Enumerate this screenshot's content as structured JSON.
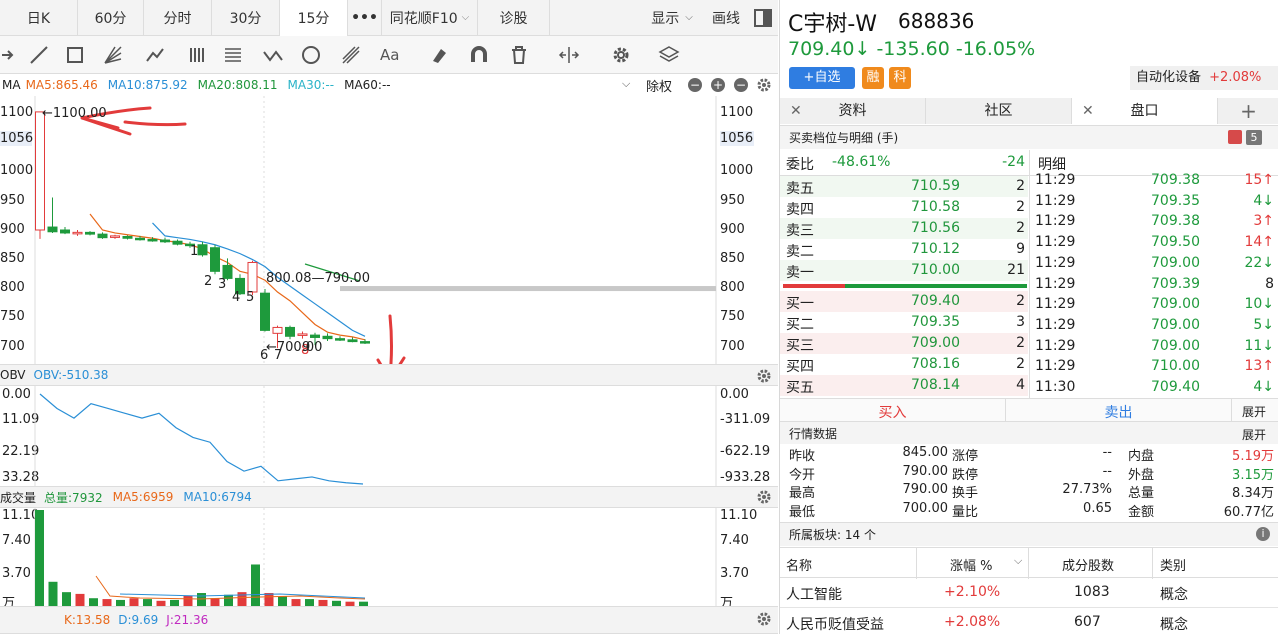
{
  "tabs": [
    "日K",
    "60分",
    "分时",
    "30分",
    "15分",
    "•••",
    "同花顺F10",
    "诊股",
    "显示",
    "画线"
  ],
  "ma_bar": {
    "ma": "MA",
    "ma5": "MA5:865.46",
    "ma10": "MA10:875.92",
    "ma20": "MA20:808.11",
    "ma30": "MA30:--",
    "ma60": "MA60:--",
    "fq": "除权"
  },
  "price_axis": {
    "left": [
      "1100",
      "1056",
      "1000",
      "950",
      "900",
      "850",
      "800",
      "750",
      "700"
    ],
    "right": [
      "1100",
      "1056",
      "1000",
      "950",
      "900",
      "850",
      "800",
      "750",
      "700"
    ]
  },
  "annotations": {
    "high": "←1100.00",
    "low": "←700.00",
    "level": "800.08—790.00",
    "digits": [
      "1",
      "2",
      "3",
      "4",
      "5",
      "6",
      "7",
      "8",
      "9"
    ]
  },
  "obv": {
    "title": "OBV",
    "value": "OBV:-510.38",
    "left": [
      "0.00",
      "11.09",
      "22.19",
      "33.28"
    ],
    "right": [
      "0.00",
      "-311.09",
      "-622.19",
      "-933.28"
    ]
  },
  "vol": {
    "title": "成交量",
    "total": "总量:7932",
    "ma5": "MA5:6959",
    "ma10": "MA10:6794",
    "left": [
      "11.10",
      "7.40",
      "3.70",
      "万"
    ],
    "right": [
      "11.10",
      "7.40",
      "3.70",
      "万"
    ]
  },
  "kdj": {
    "k": "K:13.58",
    "d": "D:9.69",
    "j": "J:21.36"
  },
  "stock": {
    "name": "C宇树-W",
    "code": "688836",
    "price": "709.40↓",
    "change": "-135.60",
    "pct": "-16.05%",
    "add": "+自选",
    "rong": "融",
    "ke": "科",
    "sector": "自动化设备",
    "sector_pct": "+2.08%"
  },
  "rtabs": [
    "资料",
    "社区",
    "盘口",
    "+"
  ],
  "orderbook": {
    "title": "买卖档位与明细 (手)",
    "badge": "5",
    "weibi_label": "委比",
    "weibi": "-48.61%",
    "weibi_diff": "-24",
    "detail_label": "明细",
    "asks": [
      {
        "l": "卖五",
        "p": "710.59",
        "v": "2"
      },
      {
        "l": "卖四",
        "p": "710.58",
        "v": "2"
      },
      {
        "l": "卖三",
        "p": "710.56",
        "v": "2"
      },
      {
        "l": "卖二",
        "p": "710.12",
        "v": "9"
      },
      {
        "l": "卖一",
        "p": "710.00",
        "v": "21"
      }
    ],
    "bids": [
      {
        "l": "买一",
        "p": "709.40",
        "v": "2"
      },
      {
        "l": "买二",
        "p": "709.35",
        "v": "3"
      },
      {
        "l": "买三",
        "p": "709.00",
        "v": "2"
      },
      {
        "l": "买四",
        "p": "708.16",
        "v": "2"
      },
      {
        "l": "买五",
        "p": "708.14",
        "v": "4"
      }
    ]
  },
  "ticks": [
    {
      "t": "11:29",
      "p": "709.38",
      "v": "15↑",
      "c": "red"
    },
    {
      "t": "11:29",
      "p": "709.35",
      "v": "4↓",
      "c": "green"
    },
    {
      "t": "11:29",
      "p": "709.38",
      "v": "3↑",
      "c": "red"
    },
    {
      "t": "11:29",
      "p": "709.50",
      "v": "14↑",
      "c": "red"
    },
    {
      "t": "11:29",
      "p": "709.00",
      "v": "22↓",
      "c": "green"
    },
    {
      "t": "11:29",
      "p": "709.39",
      "v": "8",
      "c": "dark"
    },
    {
      "t": "11:29",
      "p": "709.00",
      "v": "10↓",
      "c": "green"
    },
    {
      "t": "11:29",
      "p": "709.00",
      "v": "5↓",
      "c": "green"
    },
    {
      "t": "11:29",
      "p": "709.00",
      "v": "11↓",
      "c": "green"
    },
    {
      "t": "11:29",
      "p": "710.00",
      "v": "13↑",
      "c": "red"
    },
    {
      "t": "11:30",
      "p": "709.40",
      "v": "4↓",
      "c": "green"
    }
  ],
  "trade": {
    "buy": "买入",
    "sell": "卖出",
    "expand": "展开"
  },
  "market": {
    "title": "行情数据",
    "expand": "展开",
    "rows": [
      {
        "a": "昨收",
        "av": "845.00",
        "b": "涨停",
        "bv": "--",
        "c": "内盘",
        "cv": "5.19万"
      },
      {
        "a": "今开",
        "av": "790.00",
        "b": "跌停",
        "bv": "--",
        "c": "外盘",
        "cv": "3.15万"
      },
      {
        "a": "最高",
        "av": "790.00",
        "b": "换手",
        "bv": "27.73%",
        "c": "总量",
        "cv": "8.34万"
      },
      {
        "a": "最低",
        "av": "700.00",
        "b": "量比",
        "bv": "0.65",
        "c": "金额",
        "cv": "60.77亿"
      }
    ]
  },
  "sectors": {
    "title": "所属板块: 14 个",
    "headers": [
      "名称",
      "涨幅 %",
      "成分股数",
      "类别"
    ],
    "rows": [
      {
        "name": "人工智能",
        "pct": "+2.10%",
        "count": "1083",
        "type": "概念"
      },
      {
        "name": "人民币贬值受益",
        "pct": "+2.08%",
        "count": "607",
        "type": "概念"
      }
    ]
  },
  "colors": {
    "up": "#e23b3b",
    "down": "#1e9a3c",
    "accent": "#2f7de1",
    "orange": "#f08a1c"
  },
  "chart_data": [
    {
      "type": "candlestick",
      "ylim": [
        690,
        1110
      ],
      "candles": [
        {
          "o": 900,
          "h": 1100,
          "l": 885,
          "c": 1100
        },
        {
          "o": 905,
          "h": 955,
          "l": 895,
          "c": 897
        },
        {
          "o": 900,
          "h": 905,
          "l": 893,
          "c": 895
        },
        {
          "o": 895,
          "h": 900,
          "l": 890,
          "c": 896
        },
        {
          "o": 896,
          "h": 898,
          "l": 891,
          "c": 893
        },
        {
          "o": 893,
          "h": 896,
          "l": 885,
          "c": 887
        },
        {
          "o": 888,
          "h": 892,
          "l": 885,
          "c": 890
        },
        {
          "o": 889,
          "h": 891,
          "l": 884,
          "c": 886
        },
        {
          "o": 886,
          "h": 890,
          "l": 882,
          "c": 884
        },
        {
          "o": 884,
          "h": 888,
          "l": 880,
          "c": 883
        },
        {
          "o": 883,
          "h": 887,
          "l": 878,
          "c": 880
        },
        {
          "o": 881,
          "h": 884,
          "l": 874,
          "c": 876
        },
        {
          "o": 876,
          "h": 880,
          "l": 870,
          "c": 874
        },
        {
          "o": 875,
          "h": 880,
          "l": 855,
          "c": 858
        },
        {
          "o": 870,
          "h": 875,
          "l": 825,
          "c": 830
        },
        {
          "o": 840,
          "h": 852,
          "l": 815,
          "c": 818
        },
        {
          "o": 818,
          "h": 825,
          "l": 790,
          "c": 792
        },
        {
          "o": 795,
          "h": 848,
          "l": 790,
          "c": 845
        },
        {
          "o": 793,
          "h": 800,
          "l": 728,
          "c": 730
        },
        {
          "o": 725,
          "h": 738,
          "l": 700,
          "c": 735
        },
        {
          "o": 735,
          "h": 738,
          "l": 715,
          "c": 720
        },
        {
          "o": 722,
          "h": 728,
          "l": 716,
          "c": 724
        },
        {
          "o": 722,
          "h": 726,
          "l": 705,
          "c": 718
        },
        {
          "o": 720,
          "h": 725,
          "l": 712,
          "c": 716
        },
        {
          "o": 716,
          "h": 720,
          "l": 712,
          "c": 714
        },
        {
          "o": 714,
          "h": 718,
          "l": 710,
          "c": 711
        },
        {
          "o": 711,
          "h": 715,
          "l": 707,
          "c": 709
        }
      ],
      "ma5": [
        null,
        null,
        null,
        null,
        927,
        900,
        895,
        892,
        889,
        886,
        882,
        879,
        875,
        868,
        855,
        845,
        830,
        825,
        815,
        795,
        780,
        760,
        740,
        727,
        722,
        719,
        714
      ],
      "ma10": [
        null,
        null,
        null,
        null,
        null,
        null,
        null,
        null,
        null,
        912,
        890,
        887,
        884,
        880,
        875,
        868,
        860,
        850,
        838,
        820,
        805,
        790,
        775,
        760,
        745,
        730,
        720
      ]
    },
    {
      "type": "line",
      "name": "OBV",
      "ylim": [
        -933.28,
        0
      ],
      "values": [
        0,
        -150,
        -250,
        -100,
        -150,
        -200,
        -250,
        -200,
        -350,
        -450,
        -500,
        -700,
        -800,
        -750,
        -900,
        -880,
        -860,
        -900,
        -920,
        -933
      ]
    },
    {
      "type": "bar",
      "name": "成交量",
      "ylim": [
        0,
        11.1
      ],
      "values": [
        11.1,
        2.8,
        1.6,
        1.4,
        0.9,
        0.8,
        0.7,
        0.9,
        0.8,
        0.6,
        0.7,
        1.2,
        1.5,
        0.9,
        1.3,
        1.6,
        4.8,
        1.5,
        1.1,
        0.8,
        0.8,
        0.7,
        0.6,
        0.5,
        0.5
      ],
      "colors": [
        "g",
        "g",
        "g",
        "r",
        "g",
        "r",
        "g",
        "r",
        "g",
        "r",
        "g",
        "r",
        "g",
        "r",
        "g",
        "r",
        "g",
        "r",
        "g",
        "r",
        "g",
        "r",
        "g",
        "r",
        "g"
      ]
    }
  ]
}
